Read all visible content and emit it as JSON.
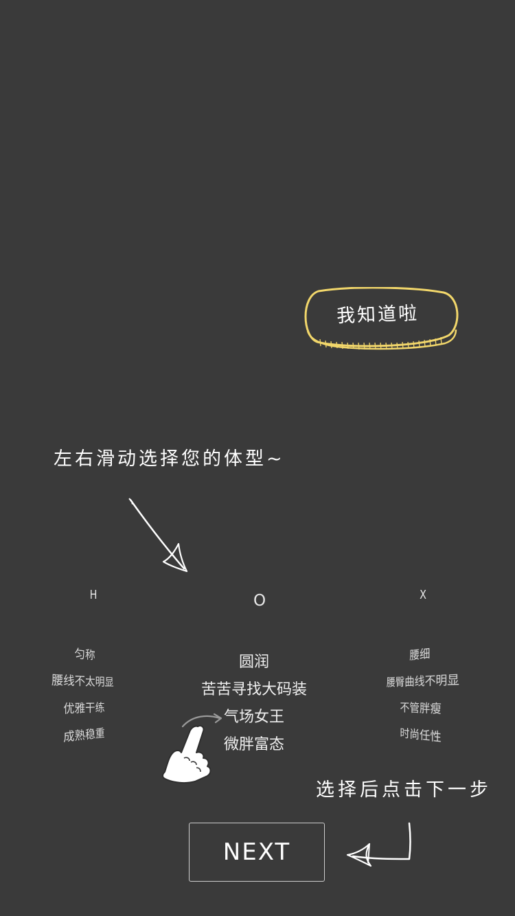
{
  "overlay": {
    "dismiss_button_label": "我知道啦",
    "swipe_hint": "左右滑动选择您的体型~",
    "next_hint": "选择后点击下一步"
  },
  "body_types": [
    {
      "letter": "H",
      "lines": [
        "匀称",
        "腰线不太明显",
        "优雅干练",
        "成熟稳重"
      ]
    },
    {
      "letter": "O",
      "lines": [
        "圆润",
        "苦苦寻找大码装",
        "气场女王",
        "微胖富态"
      ]
    },
    {
      "letter": "X",
      "lines": [
        "腰细",
        "腰臀曲线不明显",
        "不管胖瘦",
        "时尚任性"
      ]
    }
  ],
  "next_button_label": "NEXT",
  "icons": {
    "hand": "pointing-hand-icon",
    "arrow": "arrow-icon"
  },
  "colors": {
    "background": "#3a3a3a",
    "accent_outline": "#f2d76b",
    "text": "#ffffff"
  }
}
